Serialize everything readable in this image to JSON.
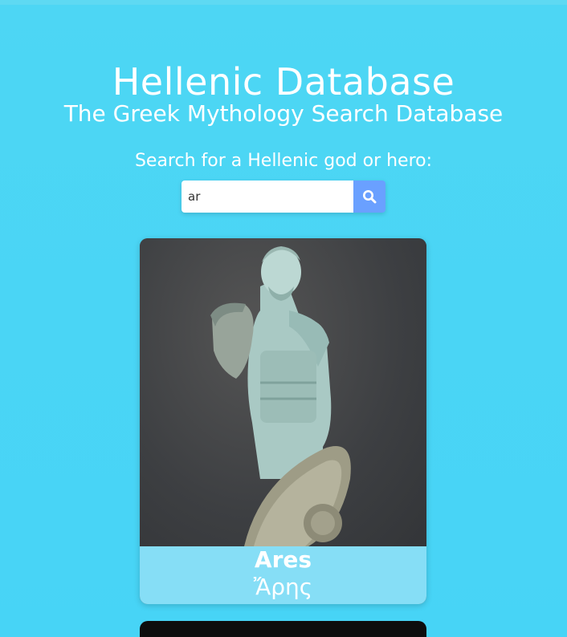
{
  "header": {
    "title": "Hellenic Database",
    "subtitle": "The Greek Mythology Search Database"
  },
  "search": {
    "prompt": "Search for a Hellenic god or hero:",
    "value": "ar",
    "button_icon": "search-icon"
  },
  "results": [
    {
      "name": "Ares",
      "greek_name": "Ἄρης",
      "image": "statue-image"
    }
  ],
  "colors": {
    "background": "#4dd6f4",
    "button": "#6aa0ff",
    "caption": "#86def6"
  }
}
